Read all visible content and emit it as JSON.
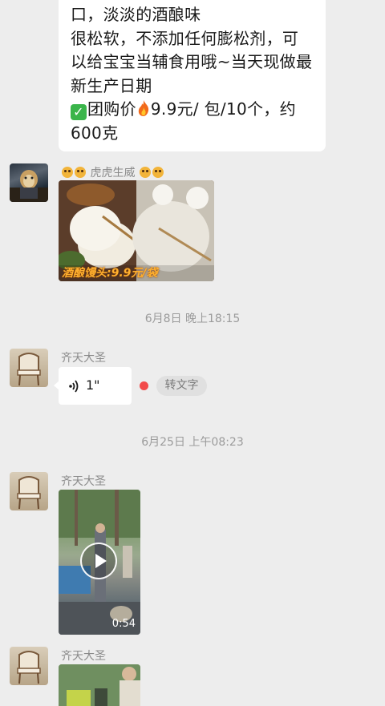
{
  "messages": {
    "text_message": {
      "lines": [
        "口，淡淡的酒酿味",
        "很松软，不添加任何膨松剂，可",
        "以给宝宝当辅食用哦~当天现做最",
        "新生产日期"
      ],
      "price_label": "团购价",
      "price_value": "9.9元/ 包/10个，约",
      "weight": "600克",
      "icon_check": "check-mark",
      "icon_fire": "fire"
    },
    "tiger_sender": {
      "name": "虎虎生威",
      "image_caption": "酒酿馒头:9.9元/袋"
    },
    "timestamp_1": "6月8日 晚上18:15",
    "voice_sender": {
      "name": "齐天大圣",
      "duration": "1\"",
      "to_text_label": "转文字"
    },
    "timestamp_2": "6月25日 上午08:23",
    "video_sender": {
      "name": "齐天大圣",
      "video_duration": "0:54"
    },
    "image_sender": {
      "name": "齐天大圣"
    }
  },
  "colors": {
    "background": "#ededed",
    "bubble": "#ffffff",
    "unread_dot": "#f24a4a",
    "check_green": "#3ab54a"
  }
}
